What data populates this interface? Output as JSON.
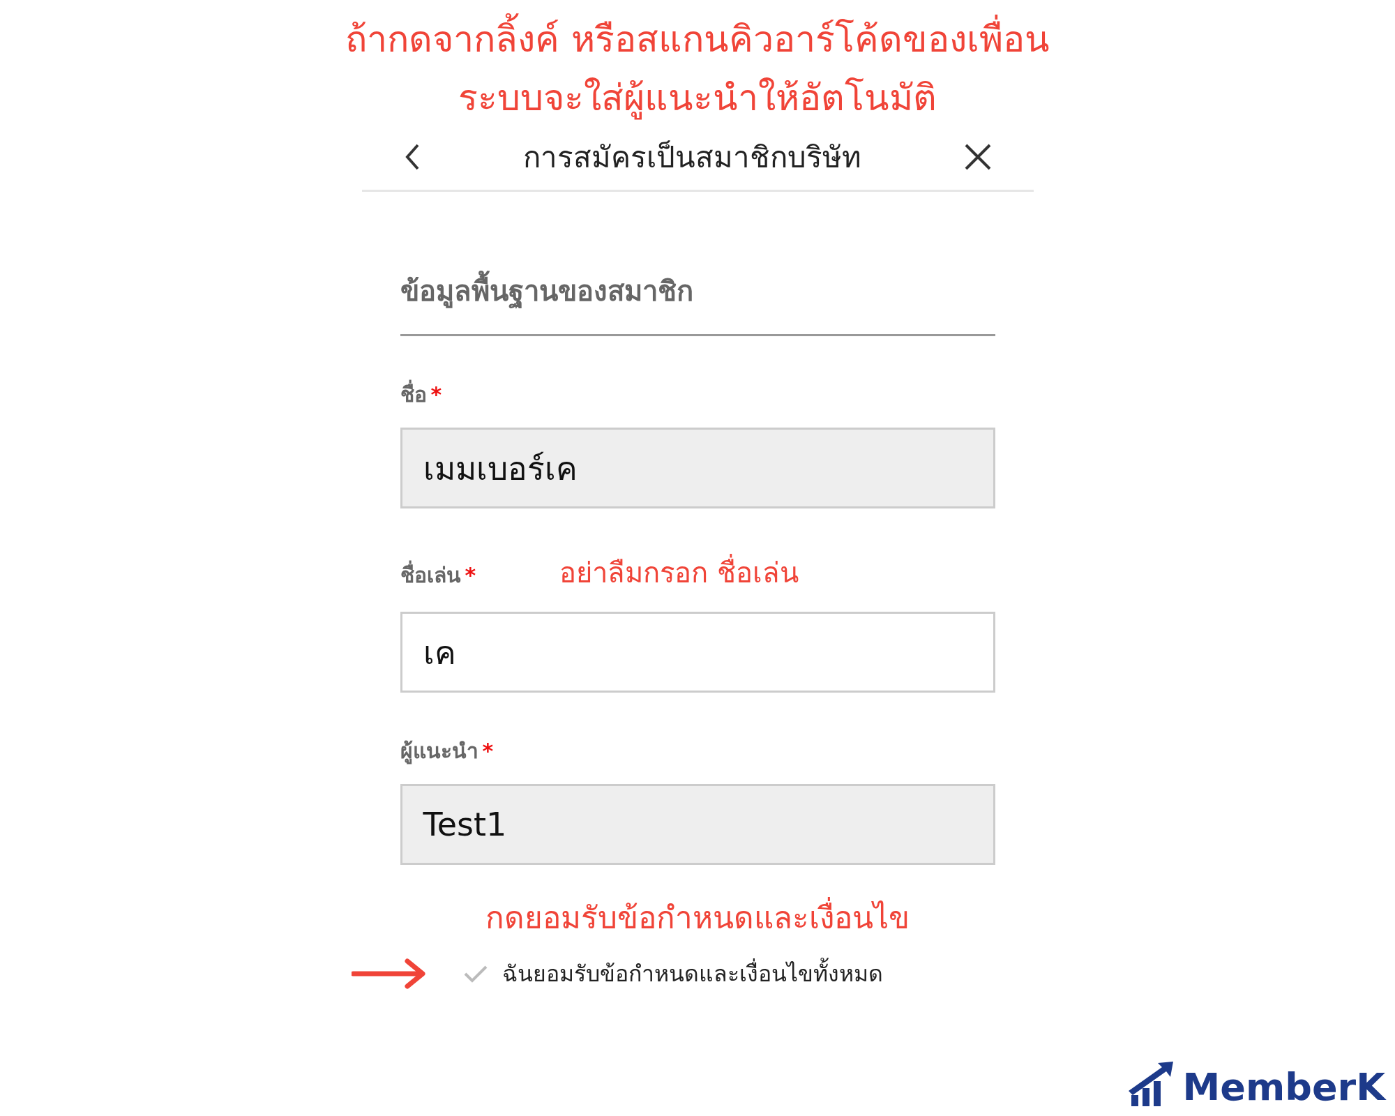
{
  "annotation_heading": [
    "ถ้ากดจากลิ้งค์ หรือสแกนคิวอาร์โค้ดของเพื่อน",
    "ระบบจะใส่ผู้แนะนำให้อัตโนมัติ"
  ],
  "header": {
    "title": "การสมัครเป็นสมาชิกบริษัท"
  },
  "section_title": "ข้อมูลพื้นฐานของสมาชิก",
  "fields": [
    {
      "label": "ชื่อ",
      "required_mark": "*",
      "value": "เมมเบอร์เค",
      "disabled": true
    },
    {
      "label": "ชื่อเล่น",
      "required_mark": "*",
      "value": "เค",
      "disabled": false,
      "note": "อย่าลืมกรอก ชื่อเล่น"
    },
    {
      "label": "ผู้แนะนำ",
      "required_mark": "*",
      "value": "Test1",
      "disabled": true
    }
  ],
  "terms_note": "กดยอมรับข้อกำหนดและเงื่อนไข",
  "terms": {
    "label": "ฉันยอมรับข้อกำหนดและเงื่อนไขทั้งหมด",
    "checked": false
  },
  "logo": {
    "text": "MemberK"
  }
}
